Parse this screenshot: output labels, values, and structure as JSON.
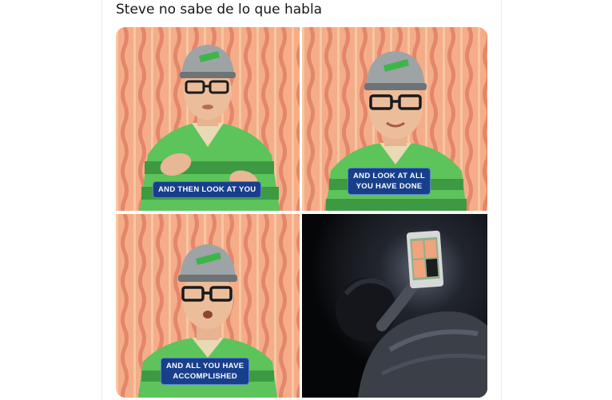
{
  "tweet": {
    "text": "Steve no sabe de lo que habla"
  },
  "panels": [
    {
      "captions": [
        "AND THEN LOOK AT YOU"
      ]
    },
    {
      "captions": [
        "AND LOOK AT ALL",
        "YOU HAVE DONE"
      ]
    },
    {
      "captions": [
        "AND ALL YOU HAVE",
        "ACCOMPLISHED"
      ]
    },
    {
      "captions": []
    }
  ],
  "colors": {
    "wallpaper": "#f2a882",
    "shirt_green": "#5cc45a",
    "caption_bg": "#173f8c"
  }
}
